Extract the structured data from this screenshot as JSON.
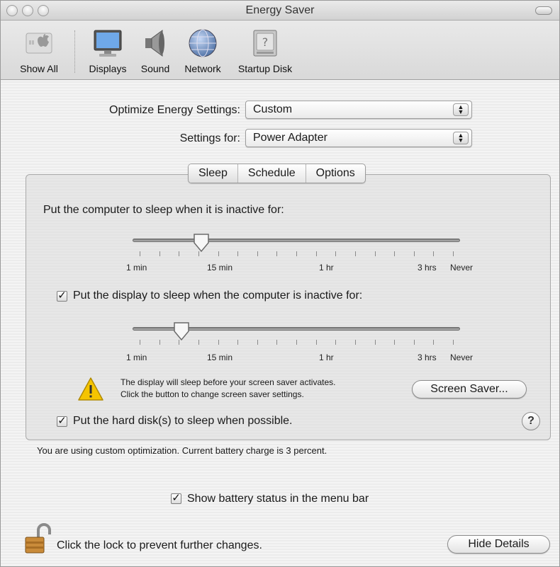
{
  "window": {
    "title": "Energy Saver"
  },
  "toolbar": {
    "items": [
      {
        "label": "Show All",
        "icon": "apple-icon"
      },
      {
        "label": "Displays",
        "icon": "display-icon"
      },
      {
        "label": "Sound",
        "icon": "speaker-icon"
      },
      {
        "label": "Network",
        "icon": "globe-icon"
      },
      {
        "label": "Startup Disk",
        "icon": "hard-disk-icon"
      }
    ]
  },
  "form": {
    "optimize_label": "Optimize Energy Settings:",
    "optimize_value": "Custom",
    "settings_for_label": "Settings for:",
    "settings_for_value": "Power Adapter"
  },
  "tabs": [
    {
      "label": "Sleep",
      "active": true
    },
    {
      "label": "Schedule",
      "active": false
    },
    {
      "label": "Options",
      "active": false
    }
  ],
  "sleep": {
    "computer_label": "Put the computer to sleep when it is inactive for:",
    "computer_slider_level": 0.21,
    "display_checkbox_checked": true,
    "display_label": "Put the display to sleep when the computer is inactive for:",
    "display_slider_level": 0.15,
    "tick_labels": [
      "1 min",
      "15 min",
      "1 hr",
      "3 hrs",
      "Never"
    ],
    "warning_line1": "The display will sleep before your screen saver activates.",
    "warning_line2": "Click the button to change screen saver settings.",
    "screen_saver_button": "Screen Saver...",
    "hard_disk_checked": true,
    "hard_disk_label": "Put the hard disk(s) to sleep when possible.",
    "help_glyph": "?"
  },
  "status": {
    "text": "You are using custom optimization. Current battery charge is 3 percent."
  },
  "battery_menu": {
    "checked": true,
    "label": "Show battery status in the menu bar"
  },
  "footer": {
    "lock_text": "Click the lock to prevent further changes.",
    "hide_details_button": "Hide Details"
  },
  "colors": {
    "warning": "#f5c400",
    "lock": "#c98b3a"
  }
}
